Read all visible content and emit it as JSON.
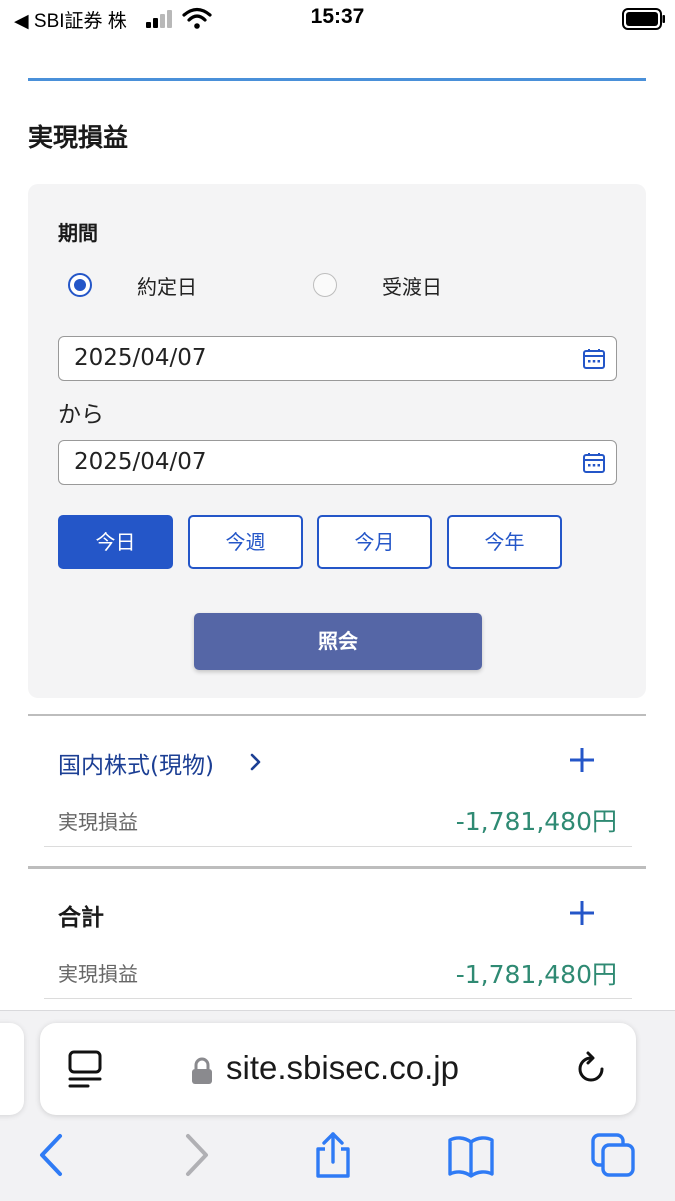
{
  "status_bar": {
    "carrier": "◀ SBI証券 株",
    "time": "15:37"
  },
  "page": {
    "title": "実現損益",
    "period": {
      "label": "期間",
      "radio_options": [
        {
          "label": "約定日",
          "selected": true
        },
        {
          "label": "受渡日",
          "selected": false
        }
      ],
      "from_date": "2025/04/07",
      "separator": "から",
      "to_date": "2025/04/07",
      "quick_buttons": [
        {
          "label": "今日",
          "active": true
        },
        {
          "label": "今週",
          "active": false
        },
        {
          "label": "今月",
          "active": false
        },
        {
          "label": "今年",
          "active": false
        }
      ],
      "search_label": "照会"
    },
    "sections": [
      {
        "title": "国内株式(現物)",
        "row_label": "実現損益",
        "row_value": "-1,781,480円"
      },
      {
        "title": "合計",
        "row_label": "実現損益",
        "row_value": "-1,781,480円"
      }
    ]
  },
  "browser": {
    "url": "site.sbisec.co.jp"
  },
  "colors": {
    "accent": "#2456c8",
    "button": "#5566a6",
    "value": "#2f8a73",
    "link": "#1c3f94",
    "rule": "#4a90d9"
  }
}
